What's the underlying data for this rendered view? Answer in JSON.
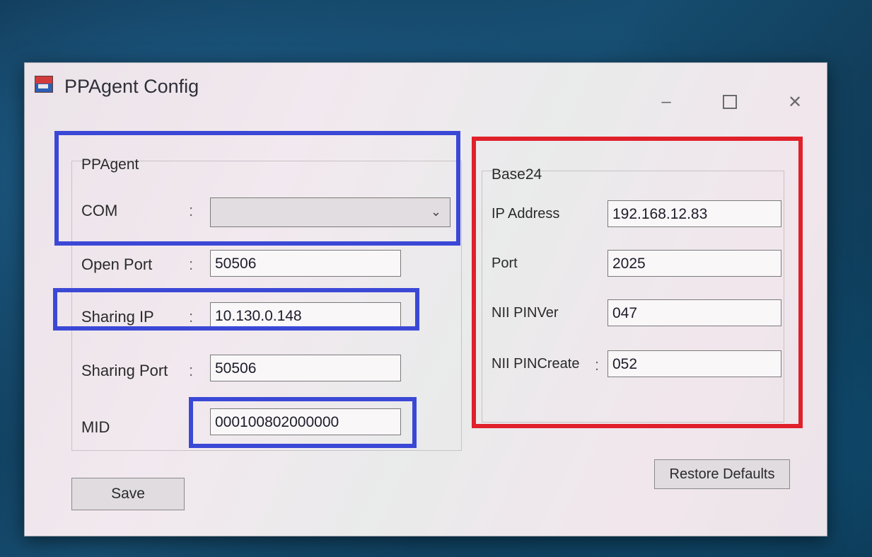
{
  "window": {
    "title": "PPAgent Config",
    "minimize_glyph": "–",
    "close_glyph": "✕"
  },
  "ppagent": {
    "group_label": "PPAgent",
    "com": {
      "label": "COM",
      "value": ""
    },
    "open_port": {
      "label": "Open Port",
      "value": "50506"
    },
    "sharing_ip": {
      "label": "Sharing IP",
      "value": "10.130.0.148"
    },
    "sharing_port": {
      "label": "Sharing Port",
      "value": "50506"
    },
    "mid": {
      "label": "MID",
      "value": "000100802000000"
    }
  },
  "base24": {
    "group_label": "Base24",
    "ip_address": {
      "label": "IP Address",
      "value": "192.168.12.83"
    },
    "port": {
      "label": "Port",
      "value": "2025"
    },
    "nii_pinver": {
      "label": "NII PINVer",
      "value": "047"
    },
    "nii_pincreate": {
      "label": "NII PINCreate",
      "value": "052"
    }
  },
  "colon": ":",
  "buttons": {
    "save": "Save",
    "restore_defaults": "Restore Defaults"
  },
  "highlight_colors": {
    "blue": "#3b48d6",
    "red": "#e0202a"
  }
}
